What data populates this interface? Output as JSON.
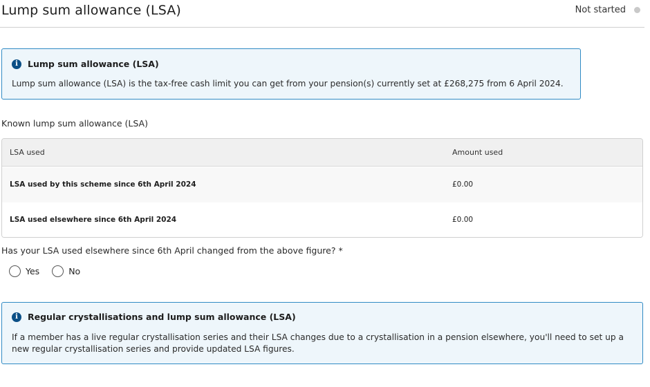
{
  "header": {
    "title": "Lump sum allowance (LSA)",
    "status": "Not started",
    "status_color": "#c9c9c9"
  },
  "lsa_info": {
    "icon": "info-icon",
    "title": "Lump sum allowance (LSA)",
    "body": "Lump sum allowance (LSA) is the tax-free cash limit you can get from your pension(s) currently set at £268,275 from 6 April 2024."
  },
  "known_lsa": {
    "label": "Known lump sum allowance (LSA)",
    "columns": [
      "LSA used",
      "Amount used"
    ],
    "rows": [
      {
        "label": "LSA used by this scheme since 6th April 2024",
        "amount": "£0.00"
      },
      {
        "label": "LSA used elsewhere since 6th April 2024",
        "amount": "£0.00"
      }
    ]
  },
  "question": {
    "text": "Has your LSA used elsewhere since 6th April changed from the above figure? *",
    "options": [
      "Yes",
      "No"
    ]
  },
  "regular_info": {
    "icon": "info-icon",
    "title": "Regular crystallisations and lump sum allowance (LSA)",
    "body": "If a member has a live regular crystallisation series and their LSA changes due to a crystallisation in a pension elsewhere, you'll need to set up a new regular crystallisation series and provide updated LSA figures."
  },
  "colors": {
    "info_border": "#2f8ac4",
    "info_background": "#eef6fb",
    "info_icon": "#0b4f86"
  }
}
